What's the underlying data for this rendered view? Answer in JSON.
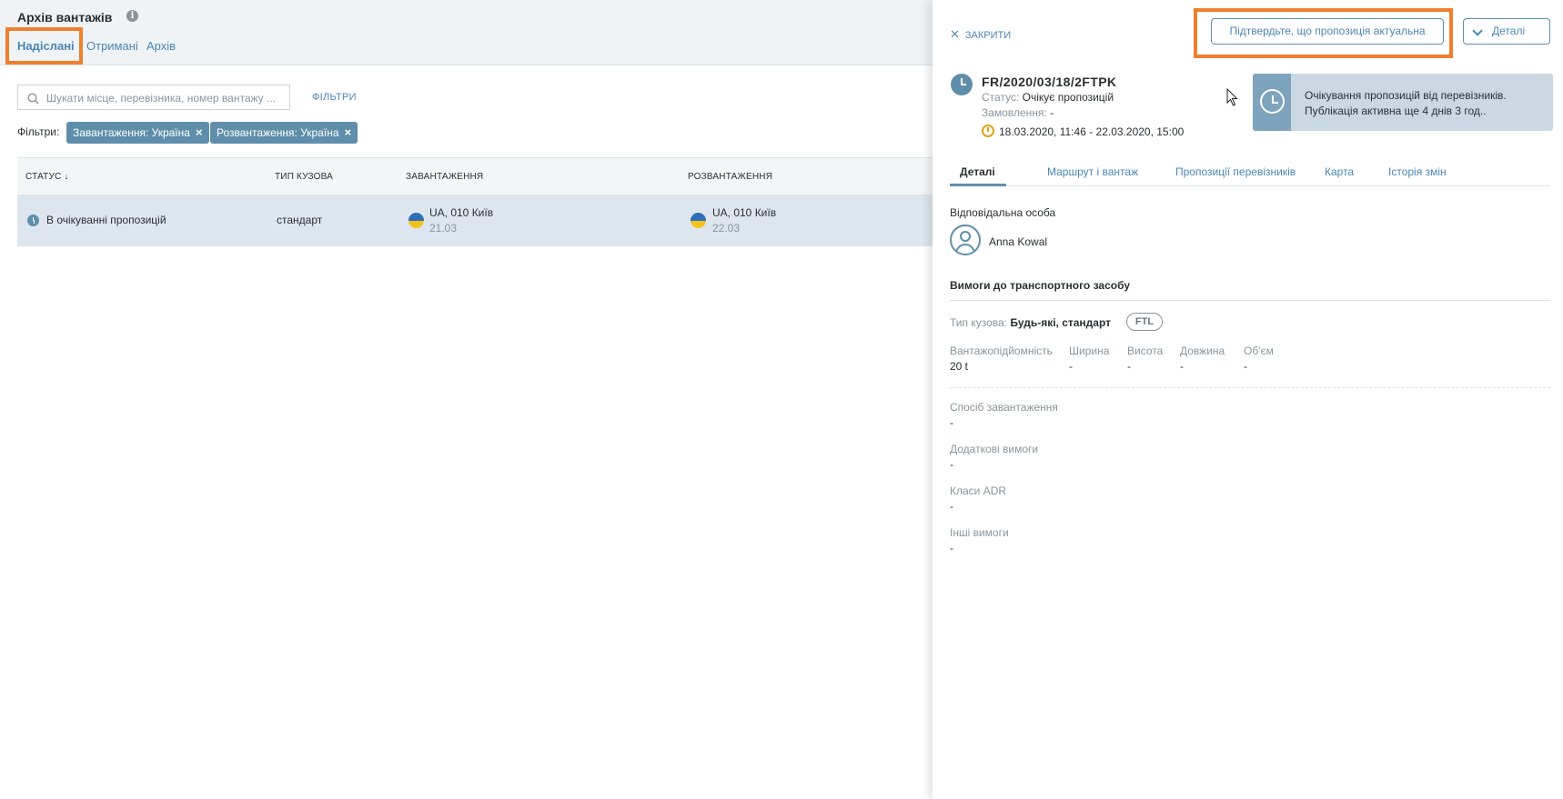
{
  "header": {
    "title": "Архів вантажів",
    "info_icon": "i",
    "tabs": [
      {
        "label": "Надіслані",
        "active": true
      },
      {
        "label": "Отримані",
        "active": false
      },
      {
        "label": "Архів",
        "active": false
      }
    ]
  },
  "search": {
    "placeholder": "Шукати місце, перевізника, номер вантажу ...",
    "filters_link": "ФІЛЬТРИ"
  },
  "filters": {
    "label": "Фільтри:",
    "chips": [
      {
        "label": "Завантаження: Україна",
        "remove": "×"
      },
      {
        "label": "Розвантаження: Україна",
        "remove": "×"
      }
    ]
  },
  "table": {
    "columns": [
      "СТАТУС ↓",
      "ТИП КУЗОВА",
      "ЗАВАНТАЖЕННЯ",
      "РОЗВАНТАЖЕННЯ"
    ],
    "rows": [
      {
        "status": "В очікуванні пропозицій",
        "body_type": "стандарт",
        "loading_place": "UA, 010 Київ",
        "loading_date": "21.03",
        "unloading_place": "UA, 010 Київ",
        "unloading_date": "22.03"
      }
    ]
  },
  "panel": {
    "close_label": "ЗАКРИТИ",
    "close_icon": "✕",
    "confirm_button": "Підтвердьте, що пропозиція актуальна",
    "details_button": "Деталі",
    "order_number": "FR/2020/03/18/2FTPK",
    "status_label": "Статус:",
    "status_value": "Очікує пропозицій",
    "order_label": "Замовлення:",
    "order_value": "-",
    "date_range": "18.03.2020, 11:46 - 22.03.2020, 15:00",
    "banner_line1": "Очікування пропозицій від перевізників.",
    "banner_line2": "Публікація активна ще 4 днів 3 год..",
    "tabs": [
      "Деталі",
      "Маршрут і вантаж",
      "Пропозиції перевізників",
      "Карта",
      "Історія змін"
    ],
    "responsible_label": "Відповідальна особа",
    "responsible_name": "Anna Kowal",
    "vehicle_section": "Вимоги до транспортного засобу",
    "body_type_label": "Тип кузова:",
    "body_type_value": "Будь-які, стандарт",
    "ftl_badge": "FTL",
    "specs": [
      {
        "label": "Вантажопідйомність",
        "value": "20 t"
      },
      {
        "label": "Ширина",
        "value": "-"
      },
      {
        "label": "Висота",
        "value": "-"
      },
      {
        "label": "Довжина",
        "value": "-"
      },
      {
        "label": "Об'єм",
        "value": "-"
      }
    ],
    "requirements": [
      {
        "label": "Спосіб завантаження",
        "value": "-"
      },
      {
        "label": "Додаткові вимоги",
        "value": "-"
      },
      {
        "label": "Класи ADR",
        "value": "-"
      },
      {
        "label": "Інші вимоги",
        "value": "-"
      }
    ]
  },
  "colors": {
    "accent": "#4b87b4",
    "chip_bg": "#5f8eab",
    "highlight": "#f07f2c",
    "row_selected": "#dde6ee"
  }
}
